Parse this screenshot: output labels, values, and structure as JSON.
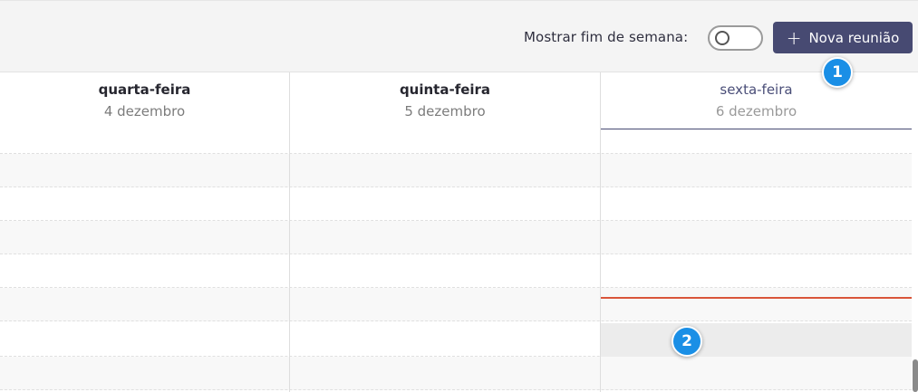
{
  "toolbar": {
    "weekend_label": "Mostrar fim de semana:",
    "weekend_toggle_on": false,
    "new_meeting_plus": "+",
    "new_meeting_label": "Nova reunião",
    "accent": "#474a72"
  },
  "days": [
    {
      "name": "quarta-feira",
      "date": "4 dezembro"
    },
    {
      "name": "quinta-feira",
      "date": "5 dezembro"
    },
    {
      "name": "sexta-feira",
      "date": "6 dezembro"
    }
  ],
  "markers": [
    "1",
    "2"
  ],
  "colors": {
    "now_line": "#d9553a",
    "marker": "#1a8fe6"
  }
}
